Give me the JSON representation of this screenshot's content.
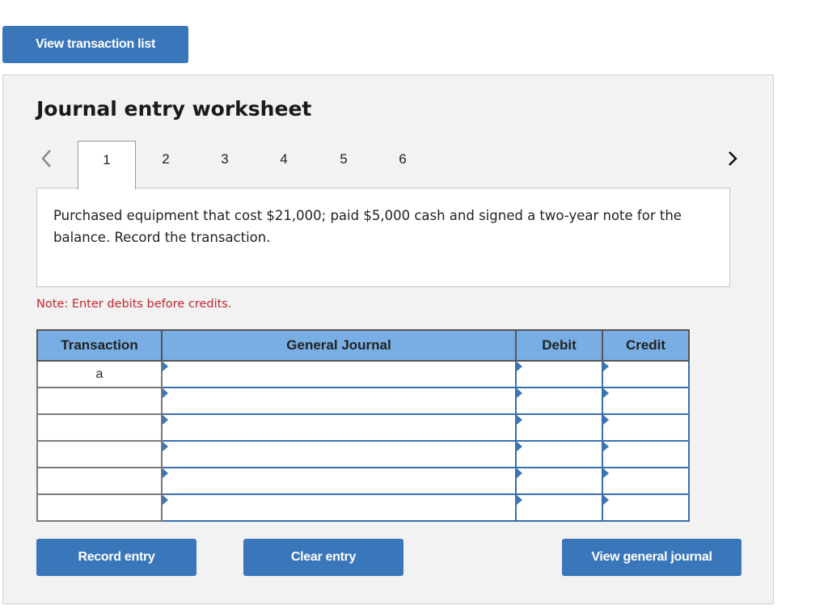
{
  "top_button": {
    "label": "View transaction list"
  },
  "worksheet": {
    "title": "Journal entry worksheet",
    "tabs": [
      "1",
      "2",
      "3",
      "4",
      "5",
      "6"
    ],
    "active_tab": "1",
    "question": "Purchased equipment that cost $21,000; paid $5,000 cash and signed a two-year note for the balance. Record the transaction.",
    "note": "Note: Enter debits before credits.",
    "table": {
      "headers": [
        "Transaction",
        "General Journal",
        "Debit",
        "Credit"
      ],
      "rows": [
        {
          "transaction": "a",
          "account": "",
          "debit": "",
          "credit": ""
        },
        {
          "transaction": "",
          "account": "",
          "debit": "",
          "credit": ""
        },
        {
          "transaction": "",
          "account": "",
          "debit": "",
          "credit": ""
        },
        {
          "transaction": "",
          "account": "",
          "debit": "",
          "credit": ""
        },
        {
          "transaction": "",
          "account": "",
          "debit": "",
          "credit": ""
        },
        {
          "transaction": "",
          "account": "",
          "debit": "",
          "credit": ""
        }
      ]
    },
    "buttons": {
      "record": "Record entry",
      "clear": "Clear entry",
      "view_general_journal": "View general journal"
    }
  },
  "icons": {
    "prev": "chevron-left-icon",
    "next": "chevron-right-icon"
  },
  "colors": {
    "button": "#3a76ba",
    "header": "#78aee3",
    "note": "#c0272d"
  }
}
